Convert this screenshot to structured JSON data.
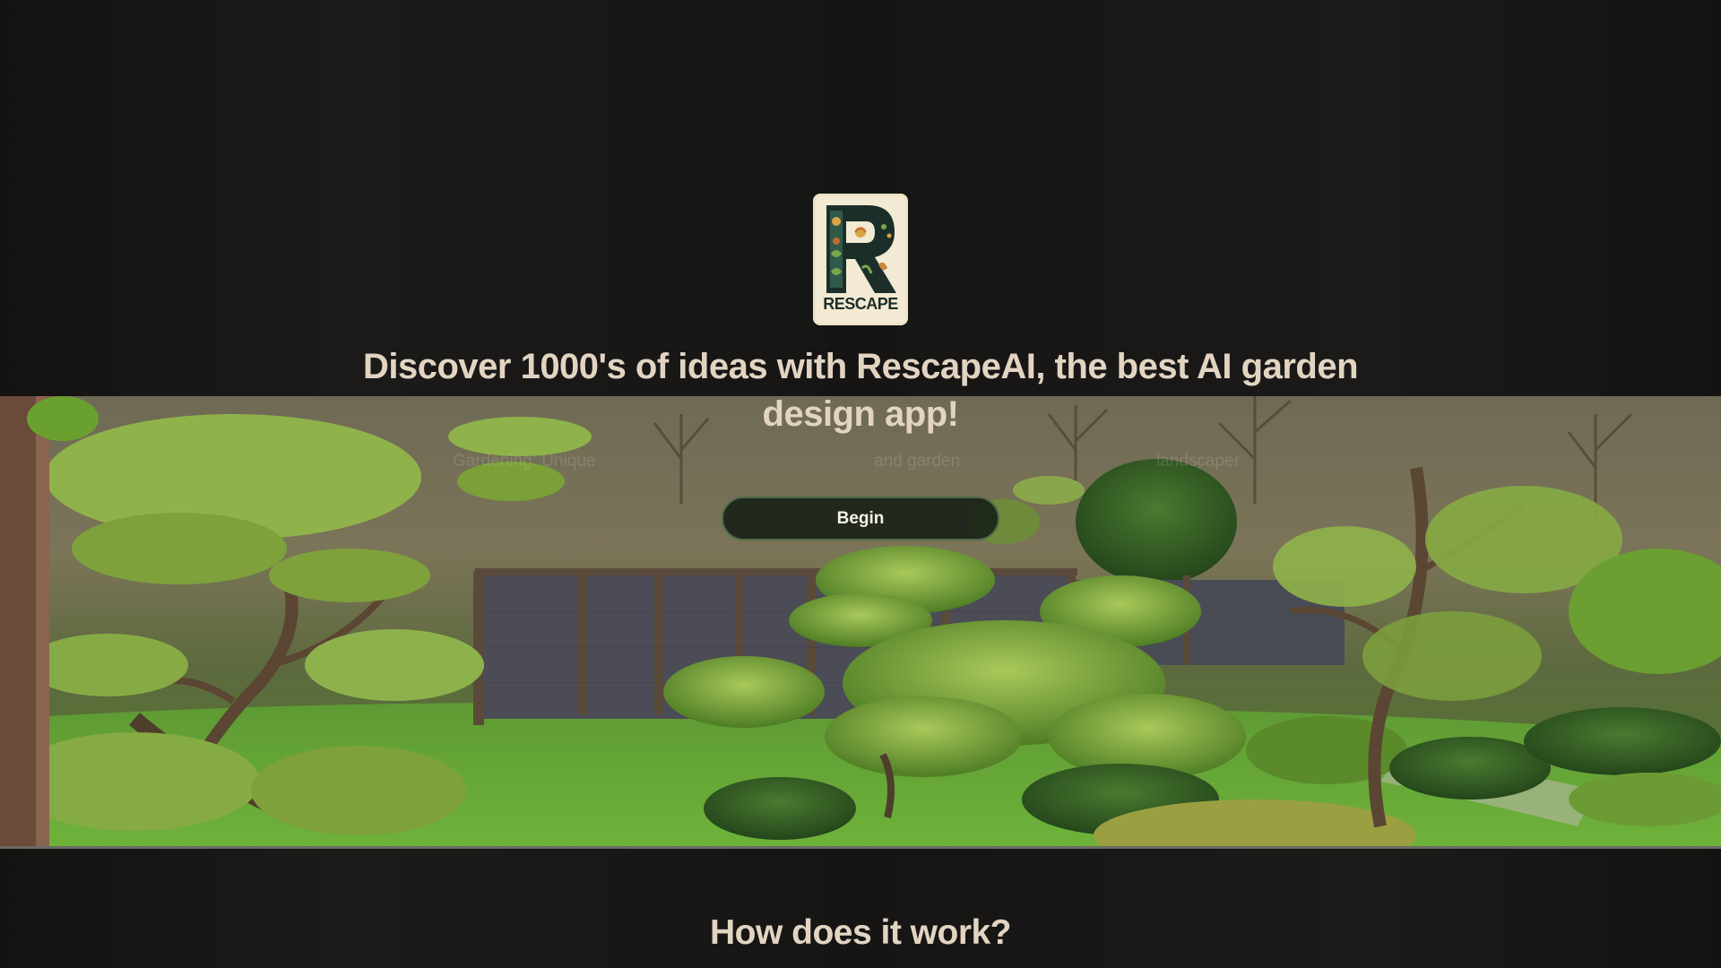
{
  "brand": {
    "logo_text": "RESCAPE",
    "logo_letter": "R"
  },
  "hero": {
    "headline": "Discover 1000's of ideas with RescapeAI, the best AI garden design app!",
    "faint_text": [
      "Gardening: Unique",
      "and garden",
      "landscaper"
    ],
    "begin_label": "Begin"
  },
  "how_it_works": {
    "heading": "How does it work?"
  },
  "colors": {
    "background": "#171615",
    "heading_text": "#e3d4c2",
    "button_border": "#4d6b46"
  }
}
